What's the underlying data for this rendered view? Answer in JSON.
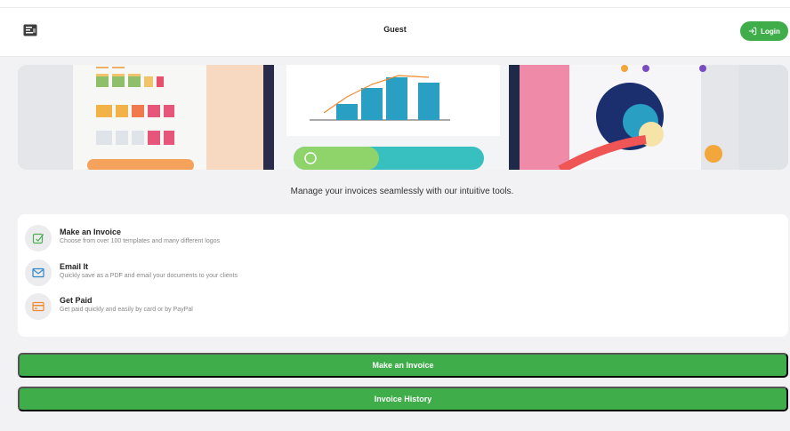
{
  "header": {
    "title": "Guest",
    "login_label": "Login",
    "logo_icon": "app-logo-icon",
    "login_icon": "sign-in-icon"
  },
  "banner": {
    "image": "invoice-illustration-banner"
  },
  "tagline": "Manage your invoices seamlessly with our intuitive tools.",
  "features": [
    {
      "icon": "edit-icon",
      "title": "Make an Invoice",
      "description": "Choose from over 100 templates and many different logos"
    },
    {
      "icon": "email-icon",
      "title": "Email It",
      "description": "Quickly save as a PDF and email your documents to your clients"
    },
    {
      "icon": "card-icon",
      "title": "Get Paid",
      "description": "Get paid quickly and easily by card or by PayPal"
    }
  ],
  "actions": {
    "make_invoice_label": "Make an Invoice",
    "invoice_history_label": "Invoice History"
  },
  "colors": {
    "accent": "#3fae4a",
    "icon_bg": "#ececee",
    "background": "#f2f2f4"
  }
}
